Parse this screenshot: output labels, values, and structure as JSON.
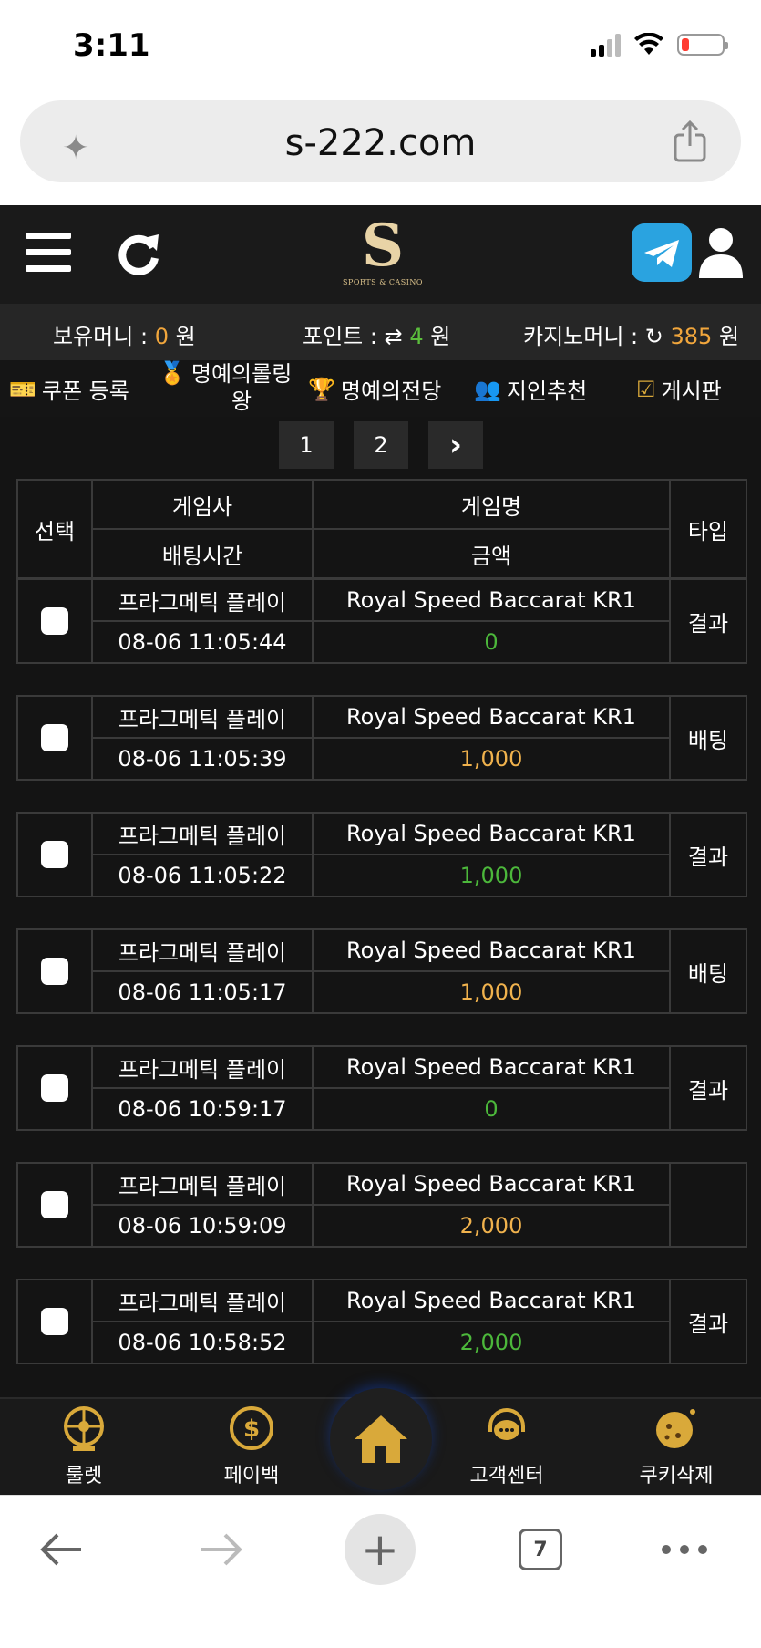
{
  "status": {
    "time": "3:11"
  },
  "browser": {
    "url": "s-222.com",
    "tab_count": "7"
  },
  "header": {
    "logo_letter": "S",
    "logo_sub": "SPORTS & CASINO"
  },
  "money": {
    "holding_label": "보유머니 :",
    "holding_value": "0",
    "holding_unit": "원",
    "point_label": "포인트 :",
    "point_value": "4",
    "point_unit": "원",
    "casino_label": "카지노머니 :",
    "casino_value": "385",
    "casino_unit": "원"
  },
  "nav": {
    "coupon": "쿠폰 등록",
    "rolling_line1": "명예의롤링",
    "rolling_line2": "왕",
    "hall": "명예의전당",
    "referral": "지인추천",
    "board": "게시판"
  },
  "pagination": {
    "pages": [
      "1",
      "2"
    ],
    "next": "›"
  },
  "table": {
    "head_select": "선택",
    "head_provider": "게임사",
    "head_game": "게임명",
    "head_type": "타입",
    "head_time": "배팅시간",
    "head_amount": "금액",
    "rows": [
      {
        "provider": "프라그메틱 플레이",
        "game": "Royal Speed Baccarat KR1",
        "time": "08-06 11:05:44",
        "amount": "0",
        "type": "결과"
      },
      {
        "provider": "프라그메틱 플레이",
        "game": "Royal Speed Baccarat KR1",
        "time": "08-06 11:05:39",
        "amount": "1,000",
        "type": "배팅"
      },
      {
        "provider": "프라그메틱 플레이",
        "game": "Royal Speed Baccarat KR1",
        "time": "08-06 11:05:22",
        "amount": "1,000",
        "type": "결과"
      },
      {
        "provider": "프라그메틱 플레이",
        "game": "Royal Speed Baccarat KR1",
        "time": "08-06 11:05:17",
        "amount": "1,000",
        "type": "배팅"
      },
      {
        "provider": "프라그메틱 플레이",
        "game": "Royal Speed Baccarat KR1",
        "time": "08-06 10:59:17",
        "amount": "0",
        "type": "결과"
      },
      {
        "provider": "프라그메틱 플레이",
        "game": "Royal Speed Baccarat KR1",
        "time": "08-06 10:59:09",
        "amount": "2,000",
        "type": ""
      },
      {
        "provider": "프라그메틱 플레이",
        "game": "Royal Speed Baccarat KR1",
        "time": "08-06 10:58:52",
        "amount": "2,000",
        "type": "결과"
      }
    ]
  },
  "bottom_nav": {
    "roulette": "룰렛",
    "payback": "페이백",
    "support": "고객센터",
    "cookie": "쿠키삭제"
  },
  "colors": {
    "accent_gold": "#d9a93a",
    "amount_green": "#4cb83b",
    "amount_orange": "#f0b24d",
    "chat_yellow": "#f7c92e"
  }
}
